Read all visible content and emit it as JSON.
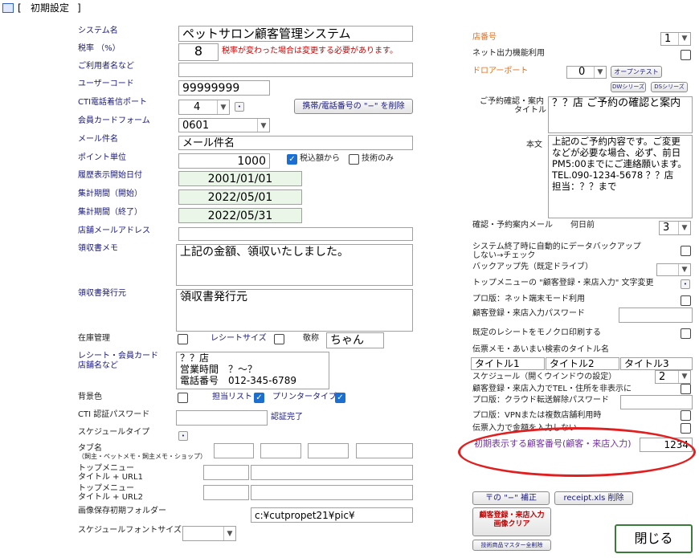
{
  "window": {
    "title_open": "[",
    "title": "初期設定",
    "title_close": "]"
  },
  "left": {
    "system_name": {
      "label": "システム名",
      "value": "ペットサロン顧客管理システム"
    },
    "tax_rate": {
      "label": "税率 （%）",
      "value": "8",
      "warning": "税率が変わった場合は変更する必要があります。"
    },
    "user_name": {
      "label": "ご利用者名など",
      "value": ""
    },
    "user_code": {
      "label": "ユーザーコード",
      "value": "99999999"
    },
    "cti_port": {
      "label": "CTI電話着信ポート",
      "value": "4",
      "button": "携帯/電話番号の \"−\" を削除"
    },
    "member_card_form": {
      "label": "会員カードフォーム",
      "value": "0601"
    },
    "mail_subject": {
      "label": "メール件名",
      "value": "メール件名"
    },
    "point_unit": {
      "label": "ポイント単位",
      "value": "1000",
      "tax_included": "税込額から",
      "skill_only": "技術のみ"
    },
    "history_start": {
      "label": "履歴表示開始日付",
      "value": "2001/01/01"
    },
    "period_start": {
      "label": "集計期間（開始）",
      "value": "2022/05/01"
    },
    "period_end": {
      "label": "集計期間（終了）",
      "value": "2022/05/31"
    },
    "store_mail": {
      "label": "店舗メールアドレス",
      "value": ""
    },
    "receipt_memo": {
      "label": "領収書メモ",
      "value": "上記の金額、領収いたしました。"
    },
    "receipt_issuer": {
      "label": "領収書発行元",
      "value": "領収書発行元"
    },
    "inventory": {
      "label": "在庫管理",
      "receipt_size": "レシートサイズ",
      "honorific_label": "敬称",
      "honorific": "ちゃん"
    },
    "receipt_store": {
      "label1": "レシート・会員カード",
      "label2": "店舗名など",
      "value": "？？店\n営業時間　？～？\n電話番号　012-345-6789"
    },
    "bg_color": {
      "label": "背景色",
      "staff_list": "担当リスト",
      "printer_type": "プリンタータイプ"
    },
    "cti_password": {
      "label": "CTI 認証パスワード",
      "status": "認証完了"
    },
    "schedule_type": {
      "label": "スケジュールタイプ"
    },
    "tab_name": {
      "label1": "タブ名",
      "label2": "（飼主・ペットメモ・飼主メモ・ショップ）"
    },
    "top_menu1": {
      "label1": "トップメニュー",
      "label2": "タイトル + URL1"
    },
    "top_menu2": {
      "label1": "トップメニュー",
      "label2": "タイトル + URL2"
    },
    "image_folder": {
      "label": "画像保存初期フォルダー",
      "value": "c:¥cutpropet21¥pic¥"
    },
    "schedule_font": {
      "label": "スケジュールフォントサイズ",
      "value": ""
    }
  },
  "right": {
    "store_no": {
      "label": "店番号",
      "value": "1"
    },
    "net_output": {
      "label": "ネット出力機能利用"
    },
    "drawer_port": {
      "label": "ドロアーポート",
      "value": "0",
      "open_test": "オープンテスト",
      "dw_series": "DWシリーズ",
      "ds_series": "DSシリーズ"
    },
    "reservation_title": {
      "label1": "ご予約確認・案内",
      "label2": "タイトル",
      "value": "？？店 ご予約の確認と案内"
    },
    "body_text": {
      "label": "本文",
      "value": "上記のご予約内容です。ご変更\nなどが必要な場合、必ず、前日\nPM5:00までにご連絡願います。\nTEL.090-1234-5678 ？？店\n担当：？？まで"
    },
    "reservation_mail": {
      "label": "確認・予約案内メール",
      "days_label": "何日前",
      "value": "3"
    },
    "auto_backup": {
      "label1": "システム終了時に自動的にデータバックアップ",
      "label2": "しない→チェック"
    },
    "backup_dest": {
      "label": "バックアップ先（既定ドライブ）",
      "value": ""
    },
    "top_menu_text": {
      "label": "トップメニューの \"顧客登録・来店入力\" 文字変更"
    },
    "pro_net": {
      "label": "プロ版：ネット端末モード利用"
    },
    "reg_password": {
      "label": "顧客登録・来店入力パスワード",
      "value": ""
    },
    "mono_receipt": {
      "label": "既定のレシートをモノクロ印刷する"
    },
    "memo_search": {
      "label": "伝票メモ・あいまい検索のタイトル名",
      "t1": "タイトル1",
      "t2": "タイトル2",
      "t3": "タイトル3"
    },
    "schedule_window": {
      "label": "スケジュール（開くウインドウの設定）",
      "value": "2"
    },
    "hide_tel": {
      "label": "顧客登録・来店入力でTEL・住所を非表示に"
    },
    "cloud_password": {
      "label": "プロ版：クラウド転送解除パスワード",
      "value": ""
    },
    "vpn": {
      "label": "プロ版：VPNまたは複数店舗利用時"
    },
    "slip_amount": {
      "label": "伝票入力で金額を入力しない"
    },
    "initial_customer": {
      "label": "初期表示する顧客番号(顧客・来店入力)",
      "value": "1234"
    },
    "buttons": {
      "minus_fix": "〒の \"−\" 補正",
      "receipt_delete": "receipt.xls 削除",
      "clear_images": "顧客登録・来店入力\n画像クリア",
      "skill_master_delete": "技術商品マスター全削除",
      "close": "閉じる"
    }
  },
  "colors": {
    "label": "#1a1a7a",
    "accent_orange": "#e07020",
    "warning_red": "#d00000",
    "highlight_ellipse": "#e02020",
    "date_field_bg": "#eaf7e8"
  }
}
